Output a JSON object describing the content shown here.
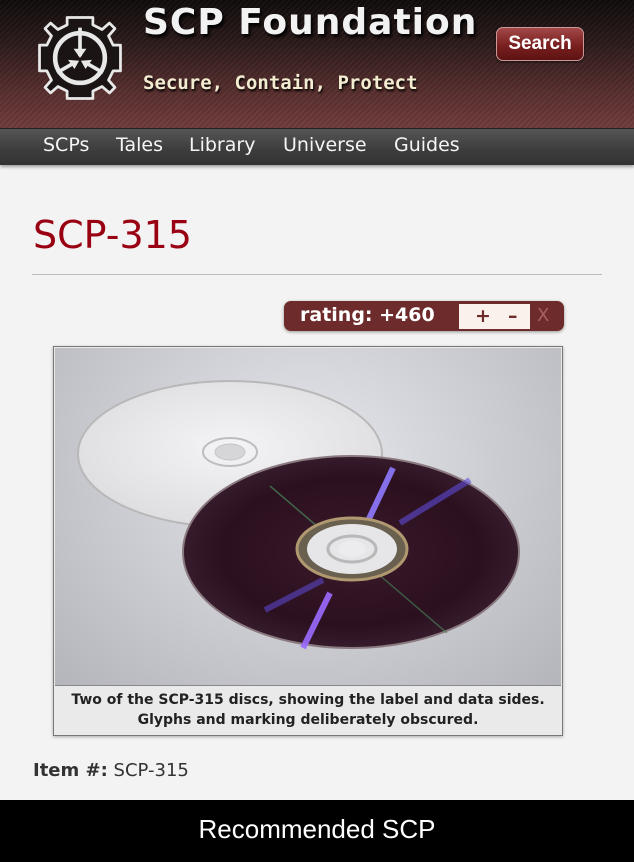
{
  "header": {
    "site_title": "SCP Foundation",
    "tagline": "Secure, Contain, Protect",
    "search_label": "Search",
    "logo_icon": "scp-logo-icon"
  },
  "nav": {
    "items": [
      {
        "label": "SCPs"
      },
      {
        "label": "Tales"
      },
      {
        "label": "Library"
      },
      {
        "label": "Universe"
      },
      {
        "label": "Guides"
      }
    ]
  },
  "page": {
    "title": "SCP-315",
    "rating": {
      "label": "rating: +460",
      "upvote": "+",
      "downvote": "–",
      "close": "X"
    },
    "figure": {
      "image_alt": "Two CDs, one label side up and one data side up",
      "caption": "Two of the SCP-315 discs, showing the label and data sides. Glyphs and marking deliberately obscured."
    },
    "item_label": "Item #:",
    "item_value": "SCP-315"
  },
  "footer": {
    "text": "Recommended SCP"
  },
  "colors": {
    "title_red": "#990011",
    "rating_bg": "#6d2b2b",
    "nav_bg": "#3c3c3c"
  }
}
